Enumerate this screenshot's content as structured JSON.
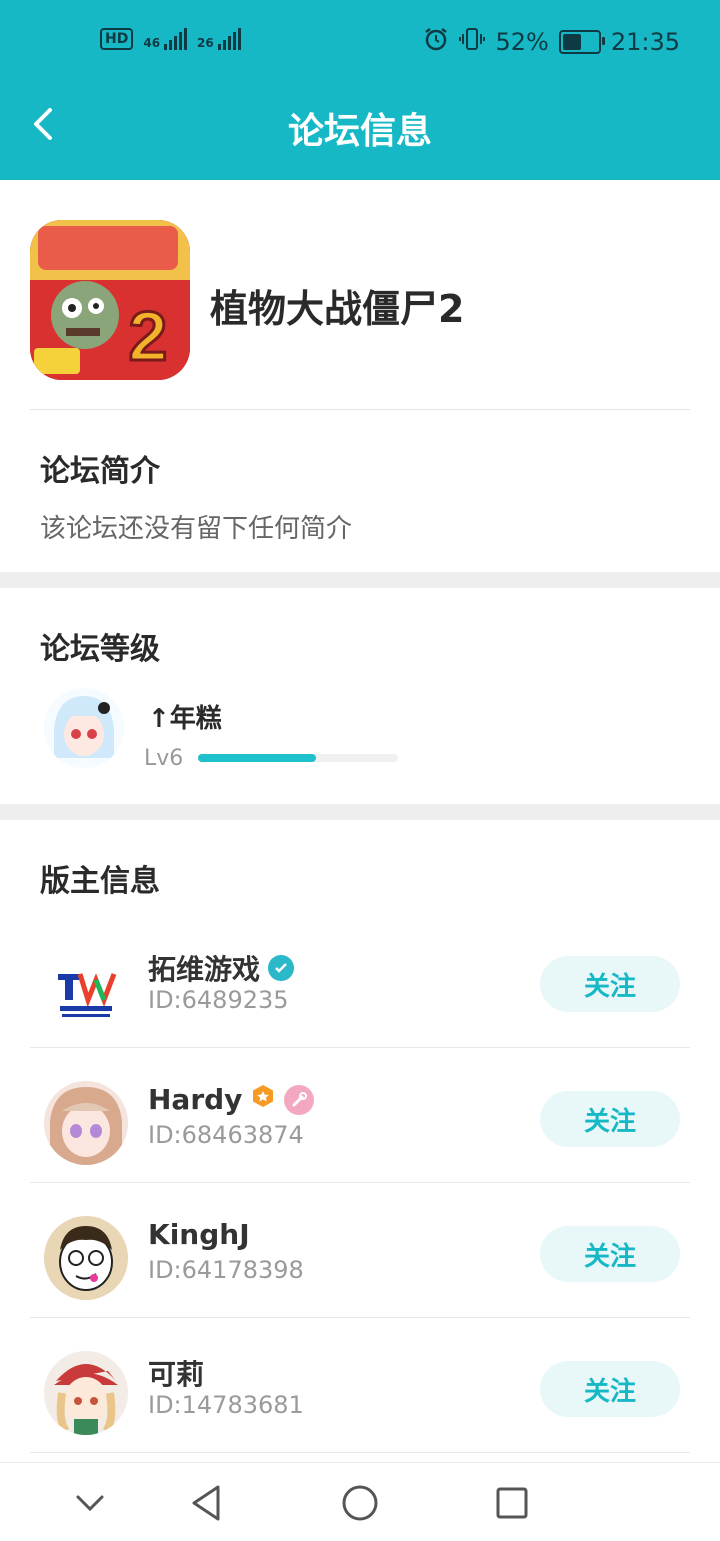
{
  "status_bar": {
    "hd": "HD",
    "sim1": "46",
    "sim2": "26",
    "battery_percent": "52%",
    "battery_level": 0.52,
    "time": "21:35"
  },
  "header": {
    "title": "论坛信息"
  },
  "forum": {
    "name": "植物大战僵尸2"
  },
  "intro": {
    "title": "论坛简介",
    "text": "该论坛还没有留下任何简介"
  },
  "level": {
    "title": "论坛等级",
    "username": "↑年糕",
    "level_label": "Lv6",
    "progress": 0.59
  },
  "moderators": {
    "title": "版主信息",
    "follow_label": "关注",
    "items": [
      {
        "name": "拓维游戏",
        "id": "ID:6489235"
      },
      {
        "name": "Hardy",
        "id": "ID:68463874"
      },
      {
        "name": "KinghJ",
        "id": "ID:64178398"
      },
      {
        "name": "可莉",
        "id": "ID:14783681"
      }
    ]
  },
  "colors": {
    "accent": "#16b8c6",
    "follow_bg": "#e8f7f8"
  }
}
